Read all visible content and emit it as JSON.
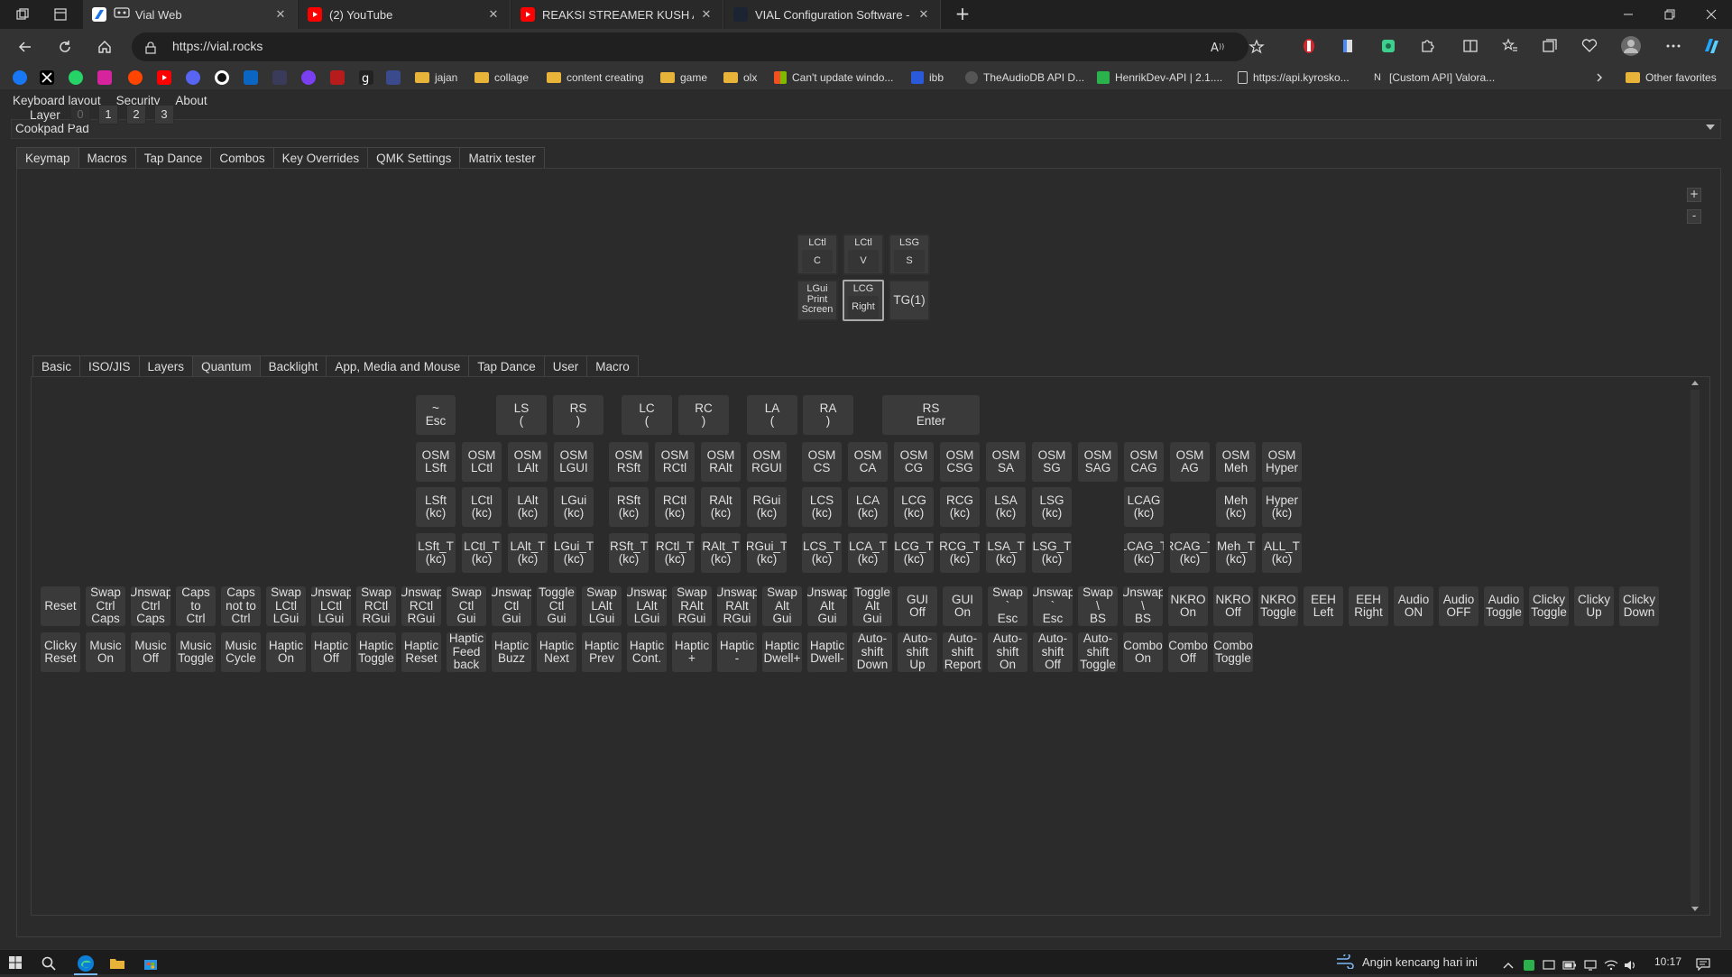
{
  "browser": {
    "tabs": [
      {
        "title": "Vial Web",
        "active": true,
        "color": "#1a73e8"
      },
      {
        "title": "(2) YouTube",
        "active": false,
        "color": "#ff0000"
      },
      {
        "title": "REAKSI STREAMER KUSH ACE N/",
        "active": false,
        "color": "#ff0000"
      },
      {
        "title": "VIAL Configuration Software - Le",
        "active": false,
        "color": "#1c2434"
      }
    ],
    "url": "https://vial.rocks",
    "favorites": [
      {
        "label": "jajan"
      },
      {
        "label": "collage"
      },
      {
        "label": "content creating"
      },
      {
        "label": "game"
      },
      {
        "label": "olx"
      },
      {
        "label": "Can't update windo..."
      },
      {
        "label": "ibb"
      },
      {
        "label": "TheAudioDB API D..."
      },
      {
        "label": "HenrikDev-API | 2.1...."
      },
      {
        "label": "https://api.kyrosko..."
      },
      {
        "label": "[Custom API] Valora..."
      },
      {
        "label": "Other favorites"
      }
    ]
  },
  "app": {
    "menu": [
      "Keyboard layout",
      "Security",
      "About"
    ],
    "device": "Cookpad Pad",
    "main_tabs": [
      "Keymap",
      "Macros",
      "Tap Dance",
      "Combos",
      "Key Overrides",
      "QMK Settings",
      "Matrix tester"
    ],
    "layer_label": "Layer",
    "layers": [
      "0",
      "1",
      "2",
      "3"
    ],
    "zoom_in": "+",
    "zoom_out": "-",
    "pad_keys": [
      {
        "top": "LCtl",
        "inner": "C"
      },
      {
        "top": "LCtl",
        "inner": "V"
      },
      {
        "top": "LSG",
        "inner": "S"
      },
      {
        "multi": "LGui\nPrint\nScreen"
      },
      {
        "top": "LCG",
        "inner": "Right"
      },
      {
        "big": "TG(1)"
      }
    ],
    "keycode_tabs": [
      "Basic",
      "ISO/JIS",
      "Layers",
      "Quantum",
      "Backlight",
      "App, Media and Mouse",
      "Tap Dance",
      "User",
      "Macro"
    ],
    "keycode_rows": [
      [
        "~\nEsc",
        "LS\n(",
        "RS\n)",
        "LC\n(",
        "RC\n)",
        "LA\n(",
        "RA\n)",
        "RS\nEnter"
      ],
      [
        "OSM\nLSft",
        "OSM\nLCtl",
        "OSM\nLAlt",
        "OSM\nLGUI",
        "OSM\nRSft",
        "OSM\nRCtl",
        "OSM\nRAlt",
        "OSM\nRGUI",
        "OSM\nCS",
        "OSM\nCA",
        "OSM\nCG",
        "OSM\nCSG",
        "OSM\nSA",
        "OSM\nSG",
        "OSM\nSAG",
        "OSM\nCAG",
        "OSM\nAG",
        "OSM\nMeh",
        "OSM\nHyper"
      ],
      [
        "LSft\n(kc)",
        "LCtl\n(kc)",
        "LAlt\n(kc)",
        "LGui\n(kc)",
        "RSft\n(kc)",
        "RCtl\n(kc)",
        "RAlt\n(kc)",
        "RGui\n(kc)",
        "LCS\n(kc)",
        "LCA\n(kc)",
        "LCG\n(kc)",
        "RCG\n(kc)",
        "LSA\n(kc)",
        "LSG\n(kc)",
        "LCAG\n(kc)",
        "Meh\n(kc)",
        "Hyper\n(kc)"
      ],
      [
        "LSft_T\n(kc)",
        "LCtl_T\n(kc)",
        "LAlt_T\n(kc)",
        "LGui_T\n(kc)",
        "RSft_T\n(kc)",
        "RCtl_T\n(kc)",
        "RAlt_T\n(kc)",
        "RGui_T\n(kc)",
        "LCS_T\n(kc)",
        "LCA_T\n(kc)",
        "LCG_T\n(kc)",
        "RCG_T\n(kc)",
        "LSA_T\n(kc)",
        "LSG_T\n(kc)",
        "LCAG_T\n(kc)",
        "RCAG_T\n(kc)",
        "Meh_T\n(kc)",
        "ALL_T\n(kc)"
      ],
      [
        "Reset",
        "Swap\nCtrl\nCaps",
        "Unswap\nCtrl\nCaps",
        "Caps\nto\nCtrl",
        "Caps\nnot to\nCtrl",
        "Swap\nLCtl\nLGui",
        "Unswap\nLCtl\nLGui",
        "Swap\nRCtl\nRGui",
        "Unswap\nRCtl\nRGui",
        "Swap\nCtl\nGui",
        "Unswap\nCtl\nGui",
        "Toggle\nCtl\nGui",
        "Swap\nLAlt\nLGui",
        "Unswap\nLAlt\nLGui",
        "Swap\nRAlt\nRGui",
        "Unswap\nRAlt\nRGui",
        "Swap\nAlt\nGui",
        "Unswap\nAlt\nGui",
        "Toggle\nAlt\nGui",
        "GUI\nOff",
        "GUI\nOn",
        "Swap\n`\nEsc",
        "Unswap\n`\nEsc",
        "Swap\n\\\nBS",
        "Unswap\n\\\nBS",
        "NKRO\nOn",
        "NKRO\nOff",
        "NKRO\nToggle",
        "EEH\nLeft",
        "EEH\nRight",
        "Audio\nON",
        "Audio\nOFF",
        "Audio\nToggle",
        "Clicky\nToggle",
        "Clicky\nUp",
        "Clicky\nDown"
      ],
      [
        "Clicky\nReset",
        "Music\nOn",
        "Music\nOff",
        "Music\nToggle",
        "Music\nCycle",
        "Haptic\nOn",
        "Haptic\nOff",
        "Haptic\nToggle",
        "Haptic\nReset",
        "Haptic\nFeed\nback",
        "Haptic\nBuzz",
        "Haptic\nNext",
        "Haptic\nPrev",
        "Haptic\nCont.",
        "Haptic\n+",
        "Haptic\n-",
        "Haptic\nDwell+",
        "Haptic\nDwell-",
        "Auto-\nshift\nDown",
        "Auto-\nshift\nUp",
        "Auto-\nshift\nReport",
        "Auto-\nshift\nOn",
        "Auto-\nshift\nOff",
        "Auto-\nshift\nToggle",
        "Combo\nOn",
        "Combo\nOff",
        "Combo\nToggle"
      ]
    ]
  },
  "taskbar": {
    "weather": "Angin kencang hari ini",
    "time": "10:17"
  }
}
